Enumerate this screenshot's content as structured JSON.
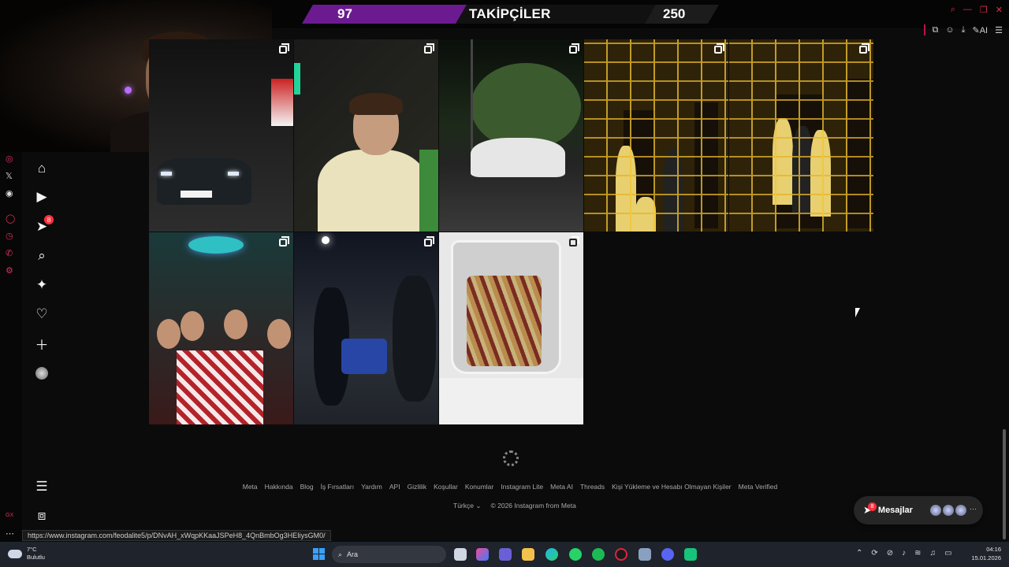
{
  "overlay": {
    "follower_count": "97",
    "title": "TAKİPÇİLER",
    "follower_goal": "250"
  },
  "browser": {
    "window_controls": [
      "search-icon",
      "minimize-icon",
      "restore-icon",
      "close-icon"
    ],
    "toolbar_icons": [
      "extensions-icon",
      "profile-icon",
      "download-icon",
      "ai-icon"
    ],
    "ai_label": "AI",
    "menu_icon": "hamburger-icon",
    "status_url": "https://www.instagram.com/feodalite5/p/DNvAH_xWqpKKaaJSPeH8_4QnBmbOg3HEIiysGM0/"
  },
  "sidebar": {
    "rail_icons": [
      "instagram-icon",
      "x-icon",
      "discord-icon",
      "circle-icon",
      "clock-icon",
      "whatsapp-icon",
      "settings-icon"
    ],
    "nav_items": [
      {
        "name": "home",
        "icon": "home-icon"
      },
      {
        "name": "reels",
        "icon": "reels-icon"
      },
      {
        "name": "messages",
        "icon": "messenger-icon",
        "badge": "8"
      },
      {
        "name": "search",
        "icon": "search-icon"
      },
      {
        "name": "explore",
        "icon": "compass-icon"
      },
      {
        "name": "notifications",
        "icon": "heart-icon"
      },
      {
        "name": "create",
        "icon": "plus-icon"
      },
      {
        "name": "profile",
        "icon": "avatar"
      }
    ],
    "more_icon": "hamburger-icon",
    "also_from_meta_icon": "meta-apps-icon"
  },
  "grid": {
    "posts": [
      {
        "id": "post-1",
        "multi": true
      },
      {
        "id": "post-2",
        "multi": true
      },
      {
        "id": "post-3",
        "multi": true
      },
      {
        "id": "post-4",
        "multi": true
      },
      {
        "id": "post-5",
        "multi": true
      },
      {
        "id": "post-6",
        "multi": true
      },
      {
        "id": "post-7",
        "multi": true
      },
      {
        "id": "post-8",
        "multi": true
      }
    ]
  },
  "footer": {
    "links": [
      "Meta",
      "Hakkında",
      "Blog",
      "İş Fırsatları",
      "Yardım",
      "API",
      "Gizlilik",
      "Koşullar",
      "Konumlar",
      "Instagram Lite",
      "Meta AI",
      "Threads",
      "Kişi Yükleme ve Hesabı Olmayan Kişiler",
      "Meta Verified"
    ],
    "language": "Türkçe",
    "copyright": "© 2026 Instagram from Meta"
  },
  "messages_pill": {
    "label": "Mesajlar",
    "badge": "8"
  },
  "taskbar": {
    "temperature": "7°C",
    "weather": "Bulutlu",
    "search_placeholder": "Ara",
    "time": "04:16",
    "date": "15.01.2026"
  },
  "colors": {
    "overlay_accent": "#6b1a8f",
    "badge": "#ff3040",
    "rail_accent": "#e0325a"
  }
}
